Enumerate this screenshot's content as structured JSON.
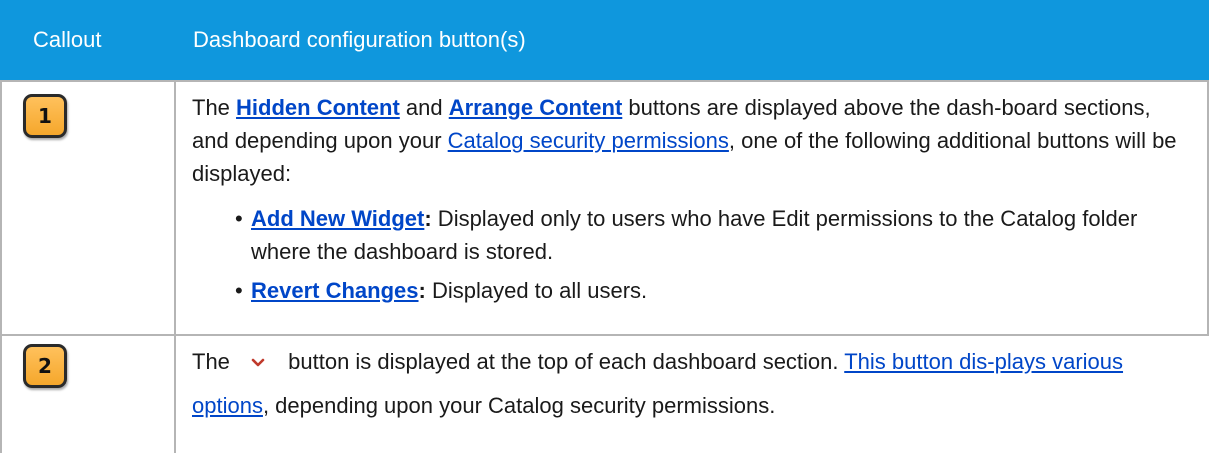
{
  "header": {
    "col1": "Callout",
    "col2": "Dashboard configuration button(s)"
  },
  "rows": [
    {
      "callout": "1",
      "p_the": "The ",
      "link_hidden": "Hidden Content",
      "p_and": " and ",
      "link_arrange": "Arrange Content",
      "p_mid": " buttons are displayed above the dash-board sections, and depending upon your ",
      "link_perms": "Catalog security permissions",
      "p_end": ", one of the following additional buttons will be displayed:",
      "bullets": [
        {
          "link": "Add New Widget",
          "sep": ":",
          "text": " Displayed only to users who have Edit permissions to the Catalog folder where the dashboard is stored."
        },
        {
          "link": "Revert Changes",
          "sep": ":",
          "text": " Displayed to all users."
        }
      ]
    },
    {
      "callout": "2",
      "p_the": "The ",
      "icon": "chevron-down-icon",
      "p_mid": " button is displayed at the top of each dashboard section. ",
      "link_options": "This button dis-plays various options",
      "p_end": ", depending upon your Catalog security permissions."
    }
  ],
  "colors": {
    "header_bg": "#0f97dd",
    "link": "#0046c8",
    "callout_fill": "#f5a72c",
    "chevron": "#c0392b"
  }
}
